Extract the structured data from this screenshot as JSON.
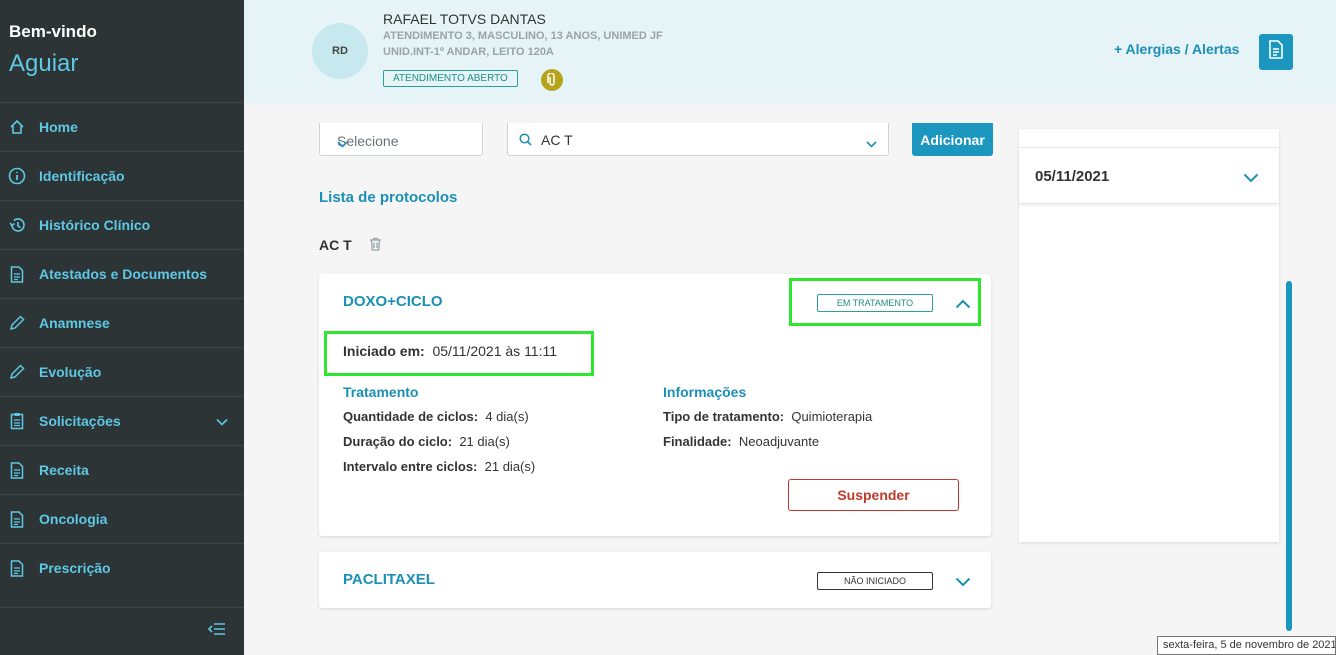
{
  "sidebar": {
    "welcome": "Bem-vindo",
    "username": "Aguiar",
    "items": [
      {
        "label": "Home",
        "icon": "home-icon"
      },
      {
        "label": "Identificação",
        "icon": "info-icon"
      },
      {
        "label": "Histórico Clínico",
        "icon": "history-icon"
      },
      {
        "label": "Atestados e Documentos",
        "icon": "document-icon"
      },
      {
        "label": "Anamnese",
        "icon": "pencil-icon"
      },
      {
        "label": "Evolução",
        "icon": "pencil-icon"
      },
      {
        "label": "Solicitações",
        "icon": "clipboard-icon"
      },
      {
        "label": "Receita",
        "icon": "document-icon"
      },
      {
        "label": "Oncologia",
        "icon": "document-icon"
      },
      {
        "label": "Prescrição",
        "icon": "document-icon"
      }
    ]
  },
  "header": {
    "initials": "RD",
    "patient_name": "RAFAEL TOTVS DANTAS",
    "line1": "ATENDIMENTO 3, MASCULINO, 13 ANOS, UNIMED JF",
    "line2": "UNID.INT-1º ANDAR, LEITO 120A",
    "status": "ATENDIMENTO ABERTO",
    "alergias": "+ Alergias / Alertas"
  },
  "filters": {
    "select_placeholder": "Selecione",
    "search_value": "AC T",
    "add_label": "Adicionar"
  },
  "protocols": {
    "title": "Lista de protocolos",
    "group_label": "AC T",
    "cards": [
      {
        "title": "DOXO+CICLO",
        "status": "EM TRATAMENTO",
        "started_label": "Iniciado em:",
        "started_value": "05/11/2021 às 11:11",
        "treatment_title": "Tratamento",
        "cycles_label": "Quantidade de ciclos:",
        "cycles_value": "4 dia(s)",
        "duration_label": "Duração do ciclo:",
        "duration_value": "21 dia(s)",
        "interval_label": "Intervalo entre ciclos:",
        "interval_value": "21 dia(s)",
        "info_title": "Informações",
        "type_label": "Tipo de tratamento:",
        "type_value": "Quimioterapia",
        "purpose_label": "Finalidade:",
        "purpose_value": "Neoadjuvante",
        "suspend_label": "Suspender"
      },
      {
        "title": "PACLITAXEL",
        "status": "NÃO INICIADO"
      }
    ]
  },
  "right_panel": {
    "date": "05/11/2021"
  },
  "tooltip": "sexta-feira, 5 de novembro de 2021",
  "colors": {
    "accent": "#1a96bf",
    "sidebar_bg": "#2d3436",
    "highlight": "#2ee62e",
    "danger": "#c0392b"
  }
}
